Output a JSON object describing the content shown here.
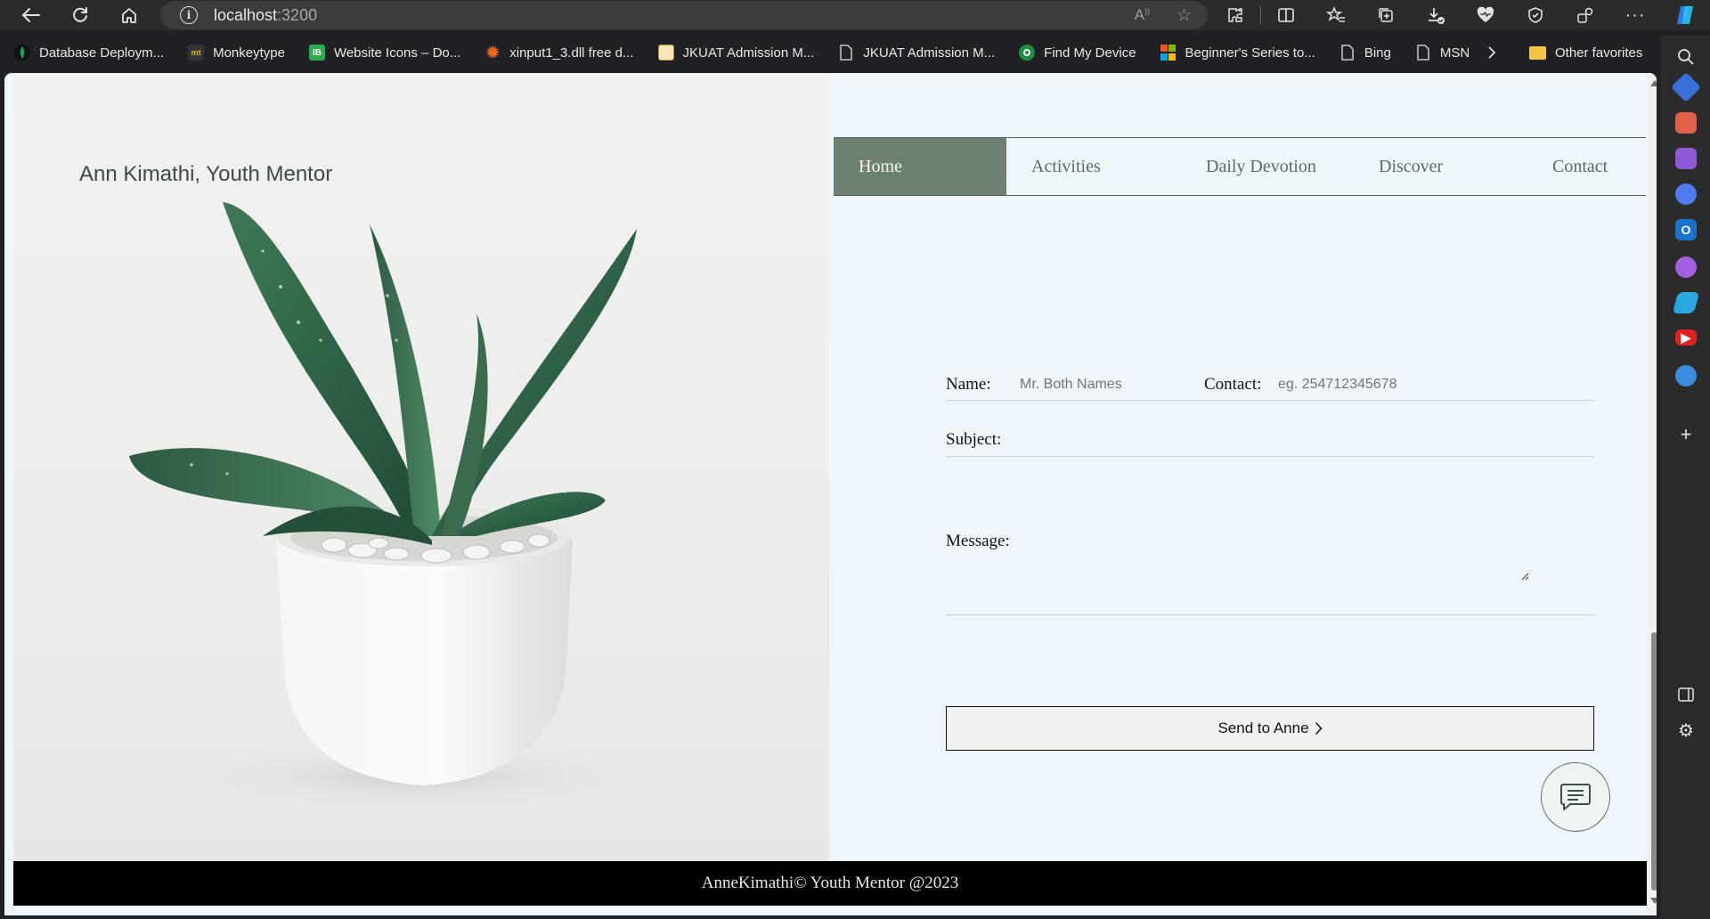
{
  "browser": {
    "url_host": "localhost",
    "url_port": ":3200",
    "bookmarks": [
      {
        "label": "Database Deploym...",
        "icon": "mongodb-leaf-icon",
        "color": "#111111"
      },
      {
        "label": "Monkeytype",
        "icon": "monkeytype-icon",
        "color": "#323437"
      },
      {
        "label": "Website Icons – Do...",
        "icon": "website-icons-icon",
        "color": "#2eaa4e"
      },
      {
        "label": "xinput1_3.dll free d...",
        "icon": "gear-orange-icon",
        "color": "#e8671b"
      },
      {
        "label": "JKUAT Admission M...",
        "icon": "jkuat-crest-icon",
        "color": "#c58f2a"
      },
      {
        "label": "JKUAT Admission M...",
        "icon": "page-icon",
        "color": "#2b2b2b"
      },
      {
        "label": "Find My Device",
        "icon": "find-device-icon",
        "color": "#1e8e3e"
      },
      {
        "label": "Beginner's Series to...",
        "icon": "microsoft-logo-icon",
        "color": "#f25022"
      },
      {
        "label": "Bing",
        "icon": "page-icon",
        "color": "#2b2b2b"
      },
      {
        "label": "MSN",
        "icon": "page-icon",
        "color": "#2b2b2b"
      }
    ],
    "other_favorites": "Other favorites"
  },
  "site": {
    "title": "Ann Kimathi, Youth Mentor",
    "nav": [
      {
        "label": "Home",
        "active": true
      },
      {
        "label": "Activities",
        "active": false
      },
      {
        "label": "Daily Devotion",
        "active": false
      },
      {
        "label": "Discover",
        "active": false
      },
      {
        "label": "Contact",
        "active": false
      }
    ]
  },
  "form": {
    "name_label": "Name:",
    "name_placeholder": "Mr. Both Names",
    "contact_label": "Contact:",
    "contact_placeholder": "eg. 254712345678",
    "subject_label": "Subject:",
    "message_label": "Message:",
    "send_label": "Send to Anne"
  },
  "footer": {
    "text": "AnneKimathi© Youth Mentor @2023"
  },
  "colors": {
    "page_bg": "#eef6fc",
    "nav_active": "#6e806f",
    "footer_bg": "#000000"
  }
}
